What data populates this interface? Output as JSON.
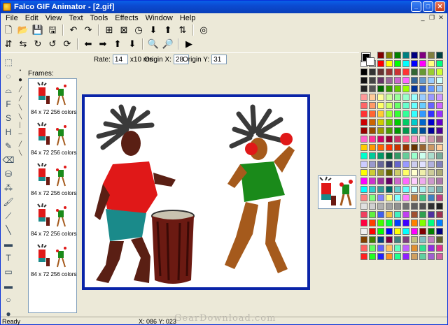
{
  "window": {
    "title": "Falco GIF Animator - [2.gif]"
  },
  "menu": [
    "File",
    "Edit",
    "View",
    "Text",
    "Tools",
    "Effects",
    "Window",
    "Help"
  ],
  "toolbar1": [
    {
      "name": "new-icon",
      "glyph": "🗋"
    },
    {
      "name": "open-icon",
      "glyph": "📂"
    },
    {
      "name": "save-icon",
      "glyph": "💾"
    },
    {
      "name": "save-as-icon",
      "glyph": "🖫"
    },
    {
      "name": "undo-icon",
      "glyph": "↶"
    },
    {
      "name": "redo-icon",
      "glyph": "↷"
    },
    {
      "name": "add-frame-icon",
      "glyph": "⊞"
    },
    {
      "name": "delete-frame-icon",
      "glyph": "⊠"
    },
    {
      "name": "timing-icon",
      "glyph": "◷"
    },
    {
      "name": "move-down-icon",
      "glyph": "⬇"
    },
    {
      "name": "move-up-icon",
      "glyph": "⬆"
    },
    {
      "name": "swap-icon",
      "glyph": "⇅"
    },
    {
      "name": "preview-icon",
      "glyph": "◎"
    }
  ],
  "toolbar2": [
    {
      "name": "flip-vertical-icon",
      "glyph": "⇵"
    },
    {
      "name": "flip-horizontal-icon",
      "glyph": "⇆"
    },
    {
      "name": "rotate-90-cw-icon",
      "glyph": "↻"
    },
    {
      "name": "rotate-90-ccw-icon",
      "glyph": "↺"
    },
    {
      "name": "rotate-icon",
      "glyph": "⟳"
    },
    {
      "name": "move-left-icon",
      "glyph": "⬅"
    },
    {
      "name": "move-right-icon",
      "glyph": "➡"
    },
    {
      "name": "move-up-icon",
      "glyph": "⬆"
    },
    {
      "name": "move-down-icon",
      "glyph": "⬇"
    },
    {
      "name": "zoom-in-icon",
      "glyph": "🔍"
    },
    {
      "name": "zoom-out-icon",
      "glyph": "🔎"
    },
    {
      "name": "play-icon",
      "glyph": "▶"
    }
  ],
  "options": {
    "rate_label": "Rate:",
    "rate_value": "14",
    "rate_unit": "x10 ms",
    "origin_x_label": "Origin X:",
    "origin_x_value": "28",
    "origin_y_label": "Origin Y:",
    "origin_y_value": "31"
  },
  "tools": [
    {
      "name": "rect-select-icon",
      "glyph": "⬚"
    },
    {
      "name": "ellipse-select-icon",
      "glyph": "◌"
    },
    {
      "name": "lasso-icon",
      "glyph": "⌓"
    },
    {
      "name": "text-frame-icon",
      "glyph": "F"
    },
    {
      "name": "stamp-icon",
      "glyph": "S"
    },
    {
      "name": "hand-icon",
      "glyph": "H"
    },
    {
      "name": "pencil-icon",
      "glyph": "✎"
    },
    {
      "name": "eraser-icon",
      "glyph": "⌫"
    },
    {
      "name": "fill-bucket-icon",
      "glyph": "⛁"
    },
    {
      "name": "spray-icon",
      "glyph": "⁂"
    },
    {
      "name": "brush-icon",
      "glyph": "🖌"
    },
    {
      "name": "eyedropper-icon",
      "glyph": "⟋"
    },
    {
      "name": "line-icon",
      "glyph": "╲"
    },
    {
      "name": "gradient-icon",
      "glyph": "▬"
    },
    {
      "name": "text-tool-icon",
      "glyph": "T"
    },
    {
      "name": "rectangle-icon",
      "glyph": "▭"
    },
    {
      "name": "filled-rectangle-icon",
      "glyph": "▬"
    },
    {
      "name": "ellipse-icon",
      "glyph": "○"
    },
    {
      "name": "filled-ellipse-icon",
      "glyph": "●"
    }
  ],
  "frames": {
    "label": "Frames:",
    "items": [
      {
        "caption": "84 x 72 256 colors"
      },
      {
        "caption": "84 x 72 256 colors"
      },
      {
        "caption": "84 x 72 256 colors"
      },
      {
        "caption": "84 x 72 256 colors"
      },
      {
        "caption": "84 x 72 256 colors"
      }
    ]
  },
  "palette_colors": [
    "#000000",
    "#808080",
    "#800000",
    "#808000",
    "#008000",
    "#008080",
    "#000080",
    "#800080",
    "#808040",
    "#004040",
    "#ffffff",
    "#c0c0c0",
    "#ff0000",
    "#ffff00",
    "#00ff00",
    "#00ffff",
    "#0000ff",
    "#ff00ff",
    "#ffff80",
    "#00ff80",
    "#000000",
    "#333333",
    "#663333",
    "#993333",
    "#cc3333",
    "#ff3333",
    "#336633",
    "#669933",
    "#99cc33",
    "#ccff33",
    "#111111",
    "#444444",
    "#663366",
    "#996699",
    "#cc66cc",
    "#ff66ff",
    "#336699",
    "#6699cc",
    "#99ccff",
    "#ccffff",
    "#222222",
    "#555555",
    "#006600",
    "#339900",
    "#66cc00",
    "#99ff00",
    "#003399",
    "#3366cc",
    "#6699ff",
    "#99ccff",
    "#ff9999",
    "#ffcc99",
    "#ffff99",
    "#ccff99",
    "#99ff99",
    "#99ffcc",
    "#99ffff",
    "#99ccff",
    "#9999ff",
    "#cc99ff",
    "#ff6666",
    "#ff9966",
    "#ffff66",
    "#ccff66",
    "#66ff66",
    "#66ffcc",
    "#66ffff",
    "#66ccff",
    "#6666ff",
    "#cc66ff",
    "#ff3333",
    "#ff6633",
    "#ffcc33",
    "#99ff33",
    "#33ff33",
    "#33ff99",
    "#33ffff",
    "#3399ff",
    "#3333ff",
    "#9933ff",
    "#cc0000",
    "#cc6600",
    "#cccc00",
    "#66cc00",
    "#00cc00",
    "#00cc66",
    "#00cccc",
    "#0066cc",
    "#0000cc",
    "#6600cc",
    "#990000",
    "#994c00",
    "#999900",
    "#4c9900",
    "#009900",
    "#00994c",
    "#009999",
    "#004c99",
    "#000099",
    "#4c0099",
    "#ff66cc",
    "#ff3399",
    "#cc0066",
    "#990033",
    "#cc3366",
    "#ff6699",
    "#ff99cc",
    "#ffccee",
    "#cc99aa",
    "#996677",
    "#ffcc00",
    "#ff9900",
    "#ff6600",
    "#ff3300",
    "#cc3300",
    "#993300",
    "#663300",
    "#996633",
    "#cc9966",
    "#ffcc99",
    "#00ffcc",
    "#00cc99",
    "#009966",
    "#006633",
    "#339966",
    "#66cc99",
    "#99ffcc",
    "#ccffee",
    "#aaddcc",
    "#77aa99",
    "#ccccff",
    "#9999cc",
    "#666699",
    "#333366",
    "#6666cc",
    "#9999ff",
    "#ccccee",
    "#e0e0ff",
    "#b0b0dd",
    "#8080bb",
    "#ffff00",
    "#cccc33",
    "#999933",
    "#666600",
    "#cccc66",
    "#ffff66",
    "#ffffcc",
    "#eeeeaa",
    "#cccc99",
    "#aaaa77",
    "#ff00ff",
    "#cc33cc",
    "#993399",
    "#660066",
    "#cc66cc",
    "#ff66ff",
    "#ffccff",
    "#eeaaee",
    "#cc99cc",
    "#aa77aa",
    "#00ffff",
    "#33cccc",
    "#339999",
    "#006666",
    "#66cccc",
    "#66ffff",
    "#ccffff",
    "#aaeeee",
    "#99cccc",
    "#77aaaa",
    "#ff8080",
    "#80ff80",
    "#8080ff",
    "#ffff80",
    "#80ffff",
    "#ff80ff",
    "#c08040",
    "#40c080",
    "#4080c0",
    "#c04080",
    "#e0e0e0",
    "#d0d0d0",
    "#b0b0b0",
    "#a0a0a0",
    "#909090",
    "#707070",
    "#606060",
    "#505050",
    "#303030",
    "#202020",
    "#f04060",
    "#60f040",
    "#4060f0",
    "#f0c040",
    "#40f0c0",
    "#c040f0",
    "#a05030",
    "#30a050",
    "#5030a0",
    "#a03050",
    "#ff0040",
    "#ff4000",
    "#40ff00",
    "#00ff40",
    "#0040ff",
    "#4000ff",
    "#ff8000",
    "#80ff00",
    "#00ff80",
    "#0080ff",
    "#f0f0f0",
    "#ff0000",
    "#00ff00",
    "#0000ff",
    "#ffff00",
    "#00ffff",
    "#ff00ff",
    "#800000",
    "#008000",
    "#000080",
    "#804000",
    "#408000",
    "#004080",
    "#800040",
    "#408080",
    "#804080",
    "#c0c080",
    "#80c0c0",
    "#c080c0",
    "#606030",
    "#ff6060",
    "#60ff60",
    "#6060ff",
    "#ffc060",
    "#60ffc0",
    "#c060ff",
    "#e09030",
    "#30e090",
    "#9030e0",
    "#e03090",
    "#ff2020",
    "#20ff20",
    "#2020ff",
    "#ff9020",
    "#20ff90",
    "#9020ff",
    "#d0a060",
    "#60d0a0",
    "#a060d0",
    "#d060a0"
  ],
  "status": {
    "text": "Ready",
    "coords": "X: 086 Y: 023",
    "watermark": "GearDownload.com"
  }
}
